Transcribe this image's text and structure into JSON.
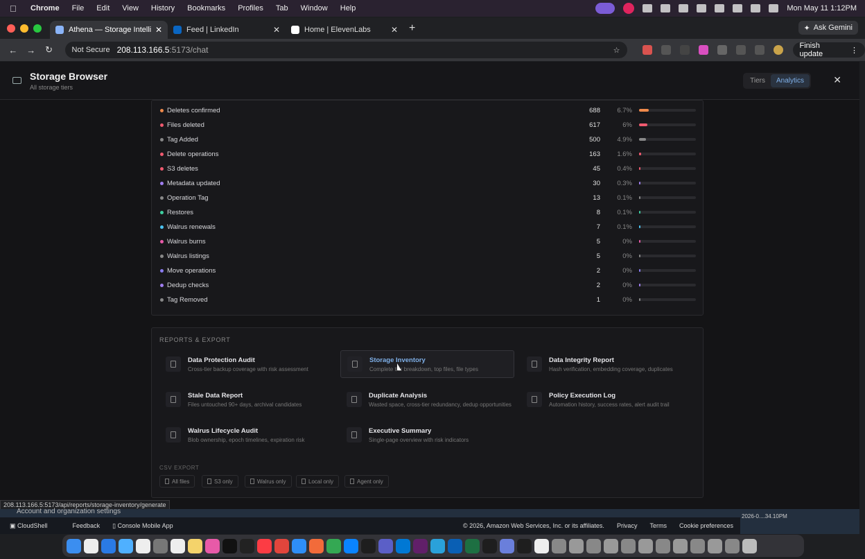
{
  "menubar": {
    "app": "Chrome",
    "items": [
      "File",
      "Edit",
      "View",
      "History",
      "Bookmarks",
      "Profiles",
      "Tab",
      "Window",
      "Help"
    ],
    "clock": "Mon May 11  1:12PM"
  },
  "tabs": [
    {
      "title": "Athena — Storage Intelligence",
      "favicon_color": "#8ab4f8",
      "close": "✕"
    },
    {
      "title": "Feed | LinkedIn",
      "favicon_color": "#0a66c2",
      "close": "✕"
    },
    {
      "title": "Home | ElevenLabs",
      "favicon_color": "#ffffff",
      "close": "✕"
    }
  ],
  "gemini_label": "Ask Gemini",
  "address": {
    "security": "Not Secure",
    "host": "208.113.166.5",
    "path": ":5173/chat",
    "update_label": "Finish update"
  },
  "page": {
    "title": "Storage Browser",
    "subtitle": "All storage tiers",
    "segments": [
      "Tiers",
      "Analytics"
    ],
    "active_segment": "Analytics"
  },
  "activity": [
    {
      "label": "Deletes confirmed",
      "count": "688",
      "pct": "6.7%",
      "fraction": 0.167,
      "color": "#f08a4b"
    },
    {
      "label": "Files deleted",
      "count": "617",
      "pct": "6%",
      "fraction": 0.15,
      "color": "#ef5a6f"
    },
    {
      "label": "Tag Added",
      "count": "500",
      "pct": "4.9%",
      "fraction": 0.12,
      "color": "#888888"
    },
    {
      "label": "Delete operations",
      "count": "163",
      "pct": "1.6%",
      "fraction": 0.04,
      "color": "#ef5a6f"
    },
    {
      "label": "S3 deletes",
      "count": "45",
      "pct": "0.4%",
      "fraction": 0.012,
      "color": "#ef5a6f"
    },
    {
      "label": "Metadata updated",
      "count": "30",
      "pct": "0.3%",
      "fraction": 0.008,
      "color": "#a07ef0"
    },
    {
      "label": "Operation Tag",
      "count": "13",
      "pct": "0.1%",
      "fraction": 0.004,
      "color": "#888888"
    },
    {
      "label": "Restores",
      "count": "8",
      "pct": "0.1%",
      "fraction": 0.003,
      "color": "#3ecfa0"
    },
    {
      "label": "Walrus renewals",
      "count": "7",
      "pct": "0.1%",
      "fraction": 0.003,
      "color": "#4cc3f0"
    },
    {
      "label": "Walrus burns",
      "count": "5",
      "pct": "0%",
      "fraction": 0.002,
      "color": "#e85aa8"
    },
    {
      "label": "Walrus listings",
      "count": "5",
      "pct": "0%",
      "fraction": 0.002,
      "color": "#888888"
    },
    {
      "label": "Move operations",
      "count": "2",
      "pct": "0%",
      "fraction": 0.001,
      "color": "#8a7cf0"
    },
    {
      "label": "Dedup checks",
      "count": "2",
      "pct": "0%",
      "fraction": 0.001,
      "color": "#a07ef0"
    },
    {
      "label": "Tag Removed",
      "count": "1",
      "pct": "0%",
      "fraction": 0.0005,
      "color": "#888888"
    }
  ],
  "reports": {
    "heading": "REPORTS & EXPORT",
    "items": [
      {
        "name": "Data Protection Audit",
        "desc": "Cross-tier backup coverage with risk assessment"
      },
      {
        "name": "Storage Inventory",
        "desc": "Complete tier breakdown, top files, file types"
      },
      {
        "name": "Data Integrity Report",
        "desc": "Hash verification, embedding coverage, duplicates"
      },
      {
        "name": "Stale Data Report",
        "desc": "Files untouched 90+ days, archival candidates"
      },
      {
        "name": "Duplicate Analysis",
        "desc": "Wasted space, cross-tier redundancy, dedup opportunities"
      },
      {
        "name": "Policy Execution Log",
        "desc": "Automation history, success rates, alert audit trail"
      },
      {
        "name": "Walrus Lifecycle Audit",
        "desc": "Blob ownership, epoch timelines, expiration risk"
      },
      {
        "name": "Executive Summary",
        "desc": "Single-page overview with risk indicators"
      }
    ],
    "csv_heading": "CSV EXPORT",
    "csv": [
      "All files",
      "S3 only",
      "Walrus only",
      "Local only",
      "Agent only"
    ]
  },
  "status_url": "208.113.166.5:5173/api/reports/storage-inventory/generate",
  "aws": {
    "account": "Account and organization settings",
    "cloudshell": "CloudShell",
    "feedback": "Feedback",
    "console_app": "Console Mobile App",
    "copyright": "© 2026, Amazon Web Services, Inc. or its affiliates.",
    "privacy": "Privacy",
    "terms": "Terms",
    "cookies": "Cookie preferences",
    "screenshot": "2026-0....34.10PM"
  }
}
